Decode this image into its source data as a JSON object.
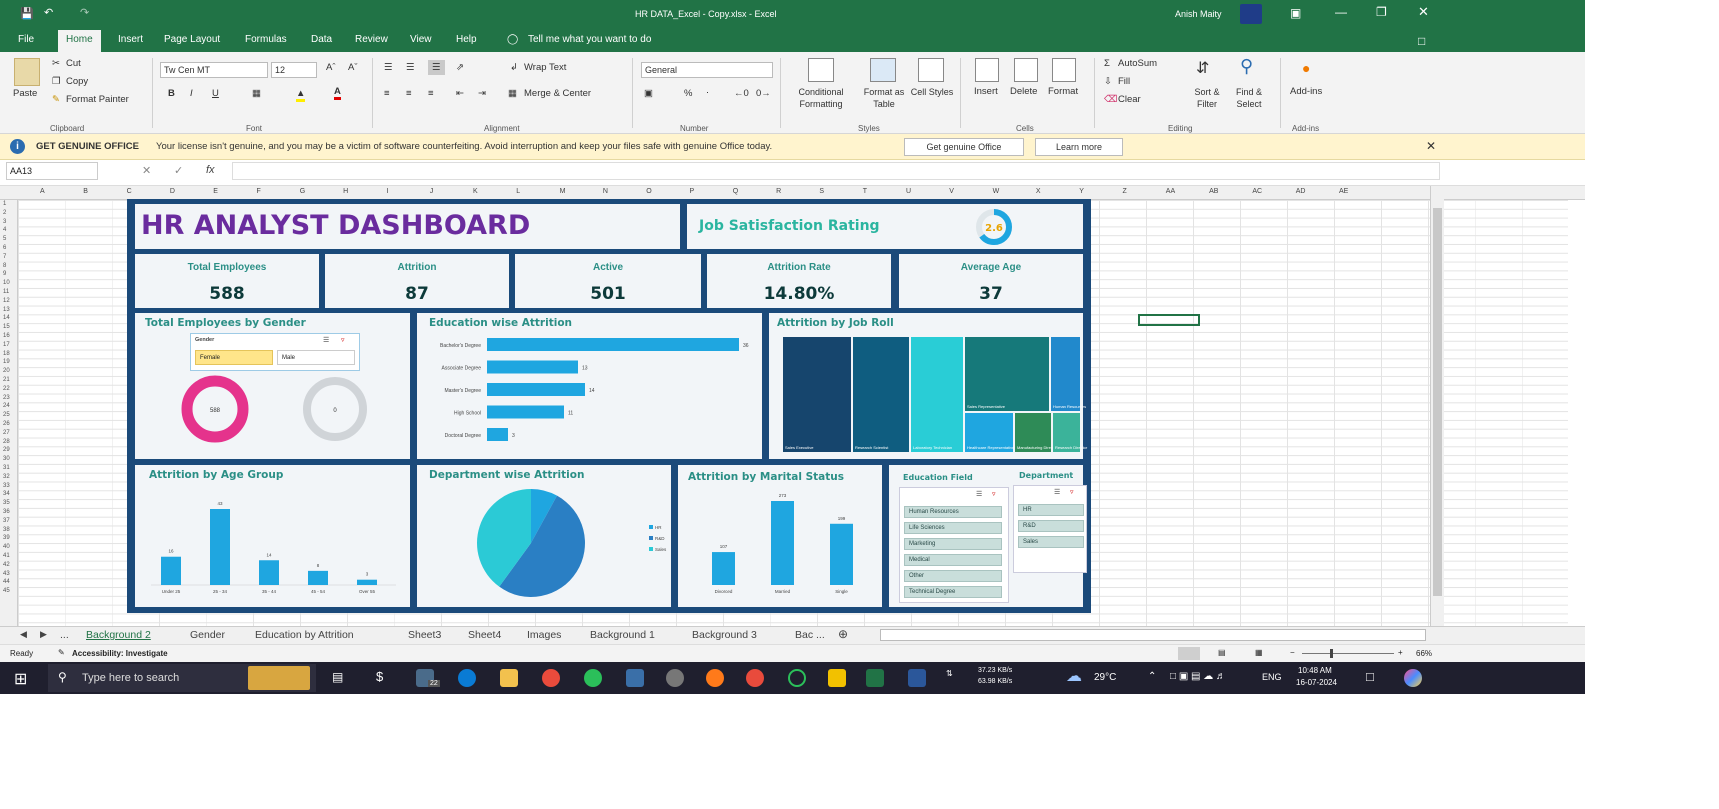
{
  "window": {
    "title": "HR DATA_Excel - Copy.xlsx  -  Excel",
    "user": "Anish Maity"
  },
  "menu": [
    "File",
    "Home",
    "Insert",
    "Page Layout",
    "Formulas",
    "Data",
    "Review",
    "View",
    "Help"
  ],
  "tell_me": "Tell me what you want to do",
  "ribbon": {
    "paste": "Paste",
    "cut": "Cut",
    "copy": "Copy",
    "format_painter": "Format Painter",
    "font_name": "Tw Cen MT",
    "font_size": "12",
    "wrap_text": "Wrap Text",
    "merge_center": "Merge & Center",
    "number_format": "General",
    "conditional_formatting": "Conditional Formatting",
    "format_as_table": "Format as Table",
    "cell_styles": "Cell Styles",
    "insert": "Insert",
    "delete": "Delete",
    "format": "Format",
    "autosum": "AutoSum",
    "fill": "Fill",
    "clear": "Clear",
    "sort_filter": "Sort & Filter",
    "find_select": "Find & Select",
    "addins": "Add-ins",
    "groups": [
      "Clipboard",
      "Font",
      "Alignment",
      "Number",
      "Styles",
      "Cells",
      "Editing",
      "Add-ins"
    ]
  },
  "warning": {
    "label": "GET GENUINE OFFICE",
    "message": "Your license isn't genuine, and you may be a victim of software counterfeiting. Avoid interruption and keep your files safe with genuine Office today.",
    "btn1": "Get genuine Office",
    "btn2": "Learn more"
  },
  "formula_bar": {
    "name_box": "AA13",
    "fx": "fx"
  },
  "columns": [
    "A",
    "B",
    "C",
    "D",
    "E",
    "F",
    "G",
    "H",
    "I",
    "J",
    "K",
    "L",
    "M",
    "N",
    "O",
    "P",
    "Q",
    "R",
    "S",
    "T",
    "U",
    "V",
    "W",
    "X",
    "Y",
    "Z",
    "AA",
    "AB",
    "AC",
    "AD",
    "AE"
  ],
  "dashboard": {
    "title": "HR ANALYST DASHBOARD",
    "job_sat_title": "Job Satisfaction Rating",
    "job_sat_value": "2.6",
    "kpis": [
      {
        "label": "Total Employees",
        "value": "588"
      },
      {
        "label": "Attrition",
        "value": "87"
      },
      {
        "label": "Active",
        "value": "501"
      },
      {
        "label": "Attrition Rate",
        "value": "14.80%"
      },
      {
        "label": "Average Age",
        "value": "37"
      }
    ],
    "gender": {
      "title": "Total Employees by Gender",
      "slicer_title": "Gender",
      "options": [
        "Female",
        "Male"
      ],
      "female_value": "588",
      "male_value": "0"
    },
    "education_attrition": {
      "title": "Education wise Attrition",
      "chart_data": {
        "type": "bar",
        "orientation": "horizontal",
        "categories": [
          "Bachelor's Degree",
          "Associate Degree",
          "Master's Degree",
          "High School",
          "Doctoral Degree"
        ],
        "values": [
          36,
          13,
          14,
          11,
          3
        ]
      }
    },
    "job_role": {
      "title": "Attrition by Job Roll",
      "labels": [
        "Sales Executive",
        "Research Scientist",
        "Laboratory Technician",
        "Sales Representative",
        "Human Resources",
        "Healthcare Representative",
        "Manufacturing Director",
        "Research Director"
      ]
    },
    "age_group": {
      "title": "Attrition by Age Group",
      "chart_data": {
        "type": "bar",
        "categories": [
          "Under 25",
          "25 - 34",
          "35 - 44",
          "45 - 54",
          "Over 55"
        ],
        "values": [
          16,
          43,
          14,
          8,
          3
        ]
      }
    },
    "department": {
      "title": "Department wise Attrition",
      "chart_data": {
        "type": "pie",
        "categories": [
          "HR",
          "R&D",
          "Sales"
        ],
        "values": [
          8,
          52,
          40
        ]
      }
    },
    "marital": {
      "title": "Attrition by Marital Status",
      "chart_data": {
        "type": "bar",
        "categories": [
          "Divorced",
          "Married",
          "Single"
        ],
        "values": [
          107,
          273,
          199
        ]
      }
    },
    "education_field": {
      "title": "Education Field",
      "items": [
        "Human Resources",
        "Life Sciences",
        "Marketing",
        "Medical",
        "Other",
        "Technical Degree"
      ]
    },
    "department_slicer": {
      "title": "Department",
      "items": [
        "HR",
        "R&D",
        "Sales"
      ]
    }
  },
  "sheet_tabs": [
    "Background 2",
    "Gender",
    "Education by Attrition",
    "Sheet3",
    "Sheet4",
    "Images",
    "Background 1",
    "Background 3",
    "Bac ..."
  ],
  "status": {
    "ready": "Ready",
    "accessibility": "Accessibility: Investigate",
    "zoom": "66%"
  },
  "taskbar": {
    "search": "Type here to search",
    "badge": "22",
    "net_up": "37.23 KB/s",
    "net_down": "63.98 KB/s",
    "weather": "29°C",
    "lang": "ENG",
    "time": "10:48 AM",
    "date": "16-07-2024"
  },
  "colors": {
    "excel_green": "#217346",
    "dashboard_navy": "#1b4a7a",
    "title_purple": "#6a2c9e",
    "bar_blue": "#1fa6e0",
    "teal": "#2b8f86",
    "female_pink": "#e5338c"
  }
}
